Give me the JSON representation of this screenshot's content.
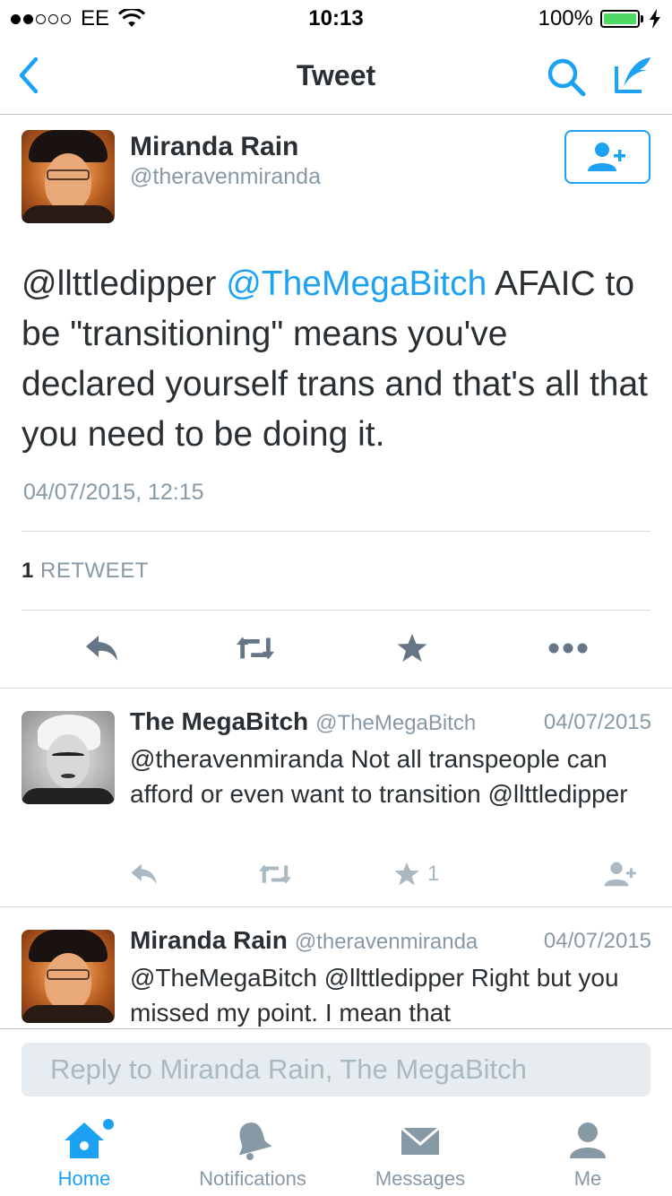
{
  "status_bar": {
    "carrier": "EE",
    "time": "10:13",
    "battery": "100%",
    "signal_bars_filled": 2,
    "signal_bars_total": 5
  },
  "nav": {
    "title": "Tweet",
    "icons": [
      "back-chevron-icon",
      "search-icon",
      "compose-icon"
    ]
  },
  "main_tweet": {
    "author_name": "Miranda Rain",
    "author_handle": "@theravenmiranda",
    "text_mention_1": "@llttledipper ",
    "text_mention_2": "@TheMegaBitch",
    "text_rest": " AFAIC to be \"transitioning\" means you've declared yourself trans and that's all that you need to be doing it.",
    "timestamp": "04/07/2015, 12:15",
    "retweet_count": "1",
    "retweet_label": "RETWEET"
  },
  "replies": [
    {
      "name": "The MegaBitch",
      "handle": "@TheMegaBitch",
      "date": "04/07/2015",
      "text": "@theravenmiranda Not all transpeople can afford or even want to transition @llttledipper",
      "like_count": "1"
    },
    {
      "name": "Miranda Rain",
      "handle": "@theravenmiranda",
      "date": "04/07/2015",
      "text": "@TheMegaBitch @llttledipper Right but you missed my point. I mean that"
    }
  ],
  "reply_bar": {
    "placeholder": "Reply to Miranda Rain, The MegaBitch"
  },
  "tabs": [
    {
      "label": "Home",
      "icon": "home-icon",
      "active": true
    },
    {
      "label": "Notifications",
      "icon": "bell-icon",
      "active": false
    },
    {
      "label": "Messages",
      "icon": "envelope-icon",
      "active": false
    },
    {
      "label": "Me",
      "icon": "person-icon",
      "active": false
    }
  ],
  "colors": {
    "accent": "#1da1f2",
    "muted": "#8899a6",
    "text": "#292f33",
    "battery": "#4cd964"
  }
}
